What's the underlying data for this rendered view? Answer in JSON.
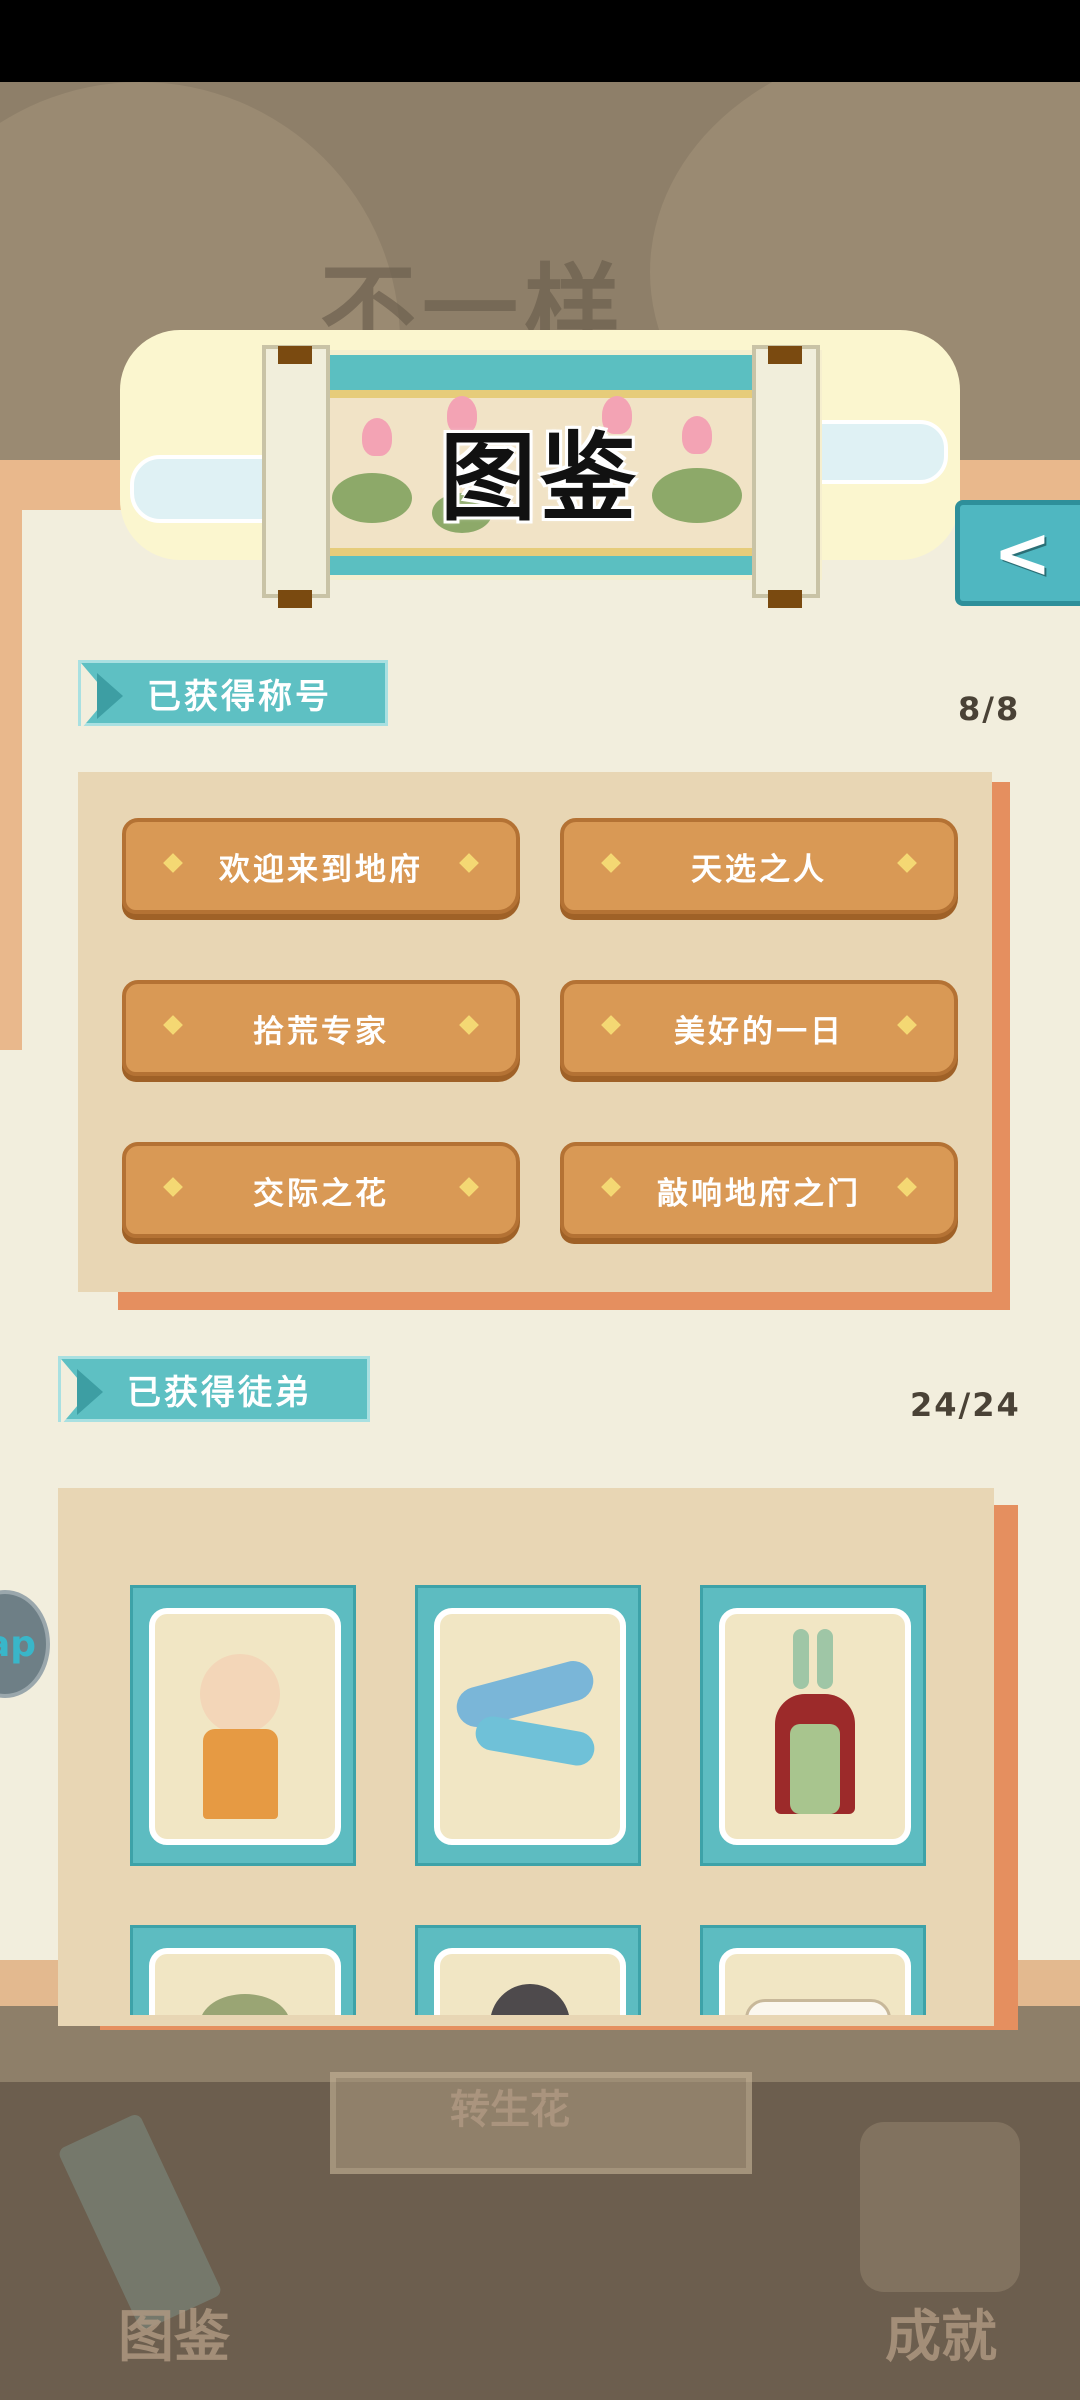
{
  "background": {
    "title": "不一样",
    "bottom_left_tab": "图鉴",
    "bottom_right_tab": "成就",
    "plaque_text": "转生花"
  },
  "banner": {
    "title": "图鉴"
  },
  "back_button": {
    "icon": "chevron-left-icon"
  },
  "titles_section": {
    "label": "已获得称号",
    "count": "8/8",
    "items": [
      "欢迎来到地府",
      "天选之人",
      "拾荒专家",
      "美好的一日",
      "交际之花",
      "敲响地府之门"
    ]
  },
  "disciples_section": {
    "label": "已获得徒弟",
    "count": "24/24",
    "cards": [
      {
        "name": "monk"
      },
      {
        "name": "blue-dragon"
      },
      {
        "name": "rabbit-eared-lady"
      },
      {
        "name": "green-turtle"
      },
      {
        "name": "hat-girl"
      },
      {
        "name": "white-creature"
      }
    ]
  },
  "side_button": {
    "label": "ap"
  },
  "colors": {
    "accent_teal": "#5ec0c3",
    "plank_wood": "#d99955",
    "panel_bg": "#f2eedd",
    "board_bg": "#e8d6b4"
  }
}
